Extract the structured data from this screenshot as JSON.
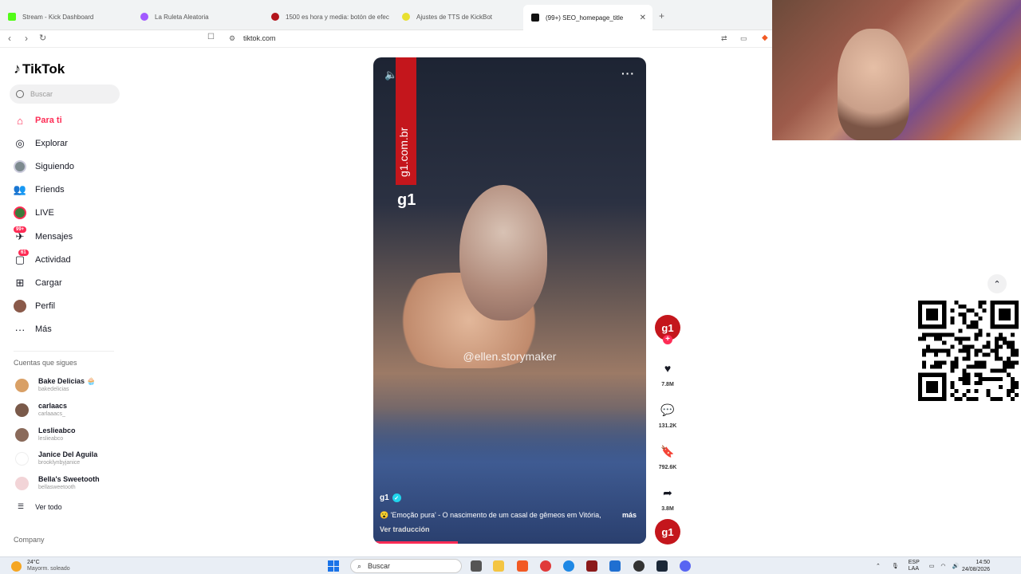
{
  "browser": {
    "tabs": [
      {
        "label": "Stream - Kick Dashboard",
        "color": "#53fc18"
      },
      {
        "label": "La Ruleta Aleatoria",
        "color": "#a259ff"
      },
      {
        "label": "1500 es hora y media: botón de efec",
        "color": "#b3141b"
      },
      {
        "label": "Ajustes de TTS de KickBot",
        "color": "#e8e030"
      },
      {
        "label": "(99+) SEO_homepage_title",
        "color": "#111111",
        "active": true
      }
    ],
    "url": "tiktok.com"
  },
  "sidebar": {
    "logo": "TikTok",
    "search_placeholder": "Buscar",
    "nav": [
      {
        "label": "Para ti",
        "icon": "home-icon",
        "active": true
      },
      {
        "label": "Explorar",
        "icon": "compass-icon"
      },
      {
        "label": "Siguiendo",
        "icon": "following-avatar-icon"
      },
      {
        "label": "Friends",
        "icon": "friends-icon"
      },
      {
        "label": "LIVE",
        "icon": "live-icon"
      },
      {
        "label": "Mensajes",
        "icon": "messages-icon",
        "badge": "99+"
      },
      {
        "label": "Actividad",
        "icon": "activity-icon",
        "badge": "61"
      },
      {
        "label": "Cargar",
        "icon": "upload-icon"
      },
      {
        "label": "Perfil",
        "icon": "profile-icon"
      },
      {
        "label": "Más",
        "icon": "more-icon"
      }
    ],
    "following_title": "Cuentas que sigues",
    "accounts": [
      {
        "name": "Bake Delicias 🧁",
        "handle": "bakedelicias",
        "color": "#d9a066"
      },
      {
        "name": "carlaacs",
        "handle": "carlaaacs_",
        "color": "#7a5a4a"
      },
      {
        "name": "Leslieabco",
        "handle": "leslieabco",
        "color": "#8a6a5a"
      },
      {
        "name": "Janice Del Aguila",
        "handle": "brooklynbyjanice",
        "color": "#ffffff"
      },
      {
        "name": "Bella's Sweetooth",
        "handle": "bellasweetooth",
        "color": "#f2d4d7"
      }
    ],
    "see_all": "Ver todo",
    "company": "Company"
  },
  "video": {
    "vertical_brand": "g1.com.br",
    "brand_mark": "g1",
    "watermark": "@ellen.storymaker",
    "author": "g1",
    "caption": "😮 'Emoção pura' - O nascimento de um casal de gêmeos em Vitória,",
    "more": "más",
    "translate": "Ver traducción",
    "progress": 0.31
  },
  "actions": {
    "avatar": "g1",
    "likes": "7.8M",
    "comments": "131.2K",
    "saves": "792.6K",
    "shares": "3.8M"
  },
  "taskbar": {
    "temperature": "24°C",
    "weather": "Mayorm. soleado",
    "search": "Buscar",
    "lang_top": "ESP",
    "lang_bottom": "LAA",
    "time": "14:50",
    "date": "24/08/2026"
  }
}
